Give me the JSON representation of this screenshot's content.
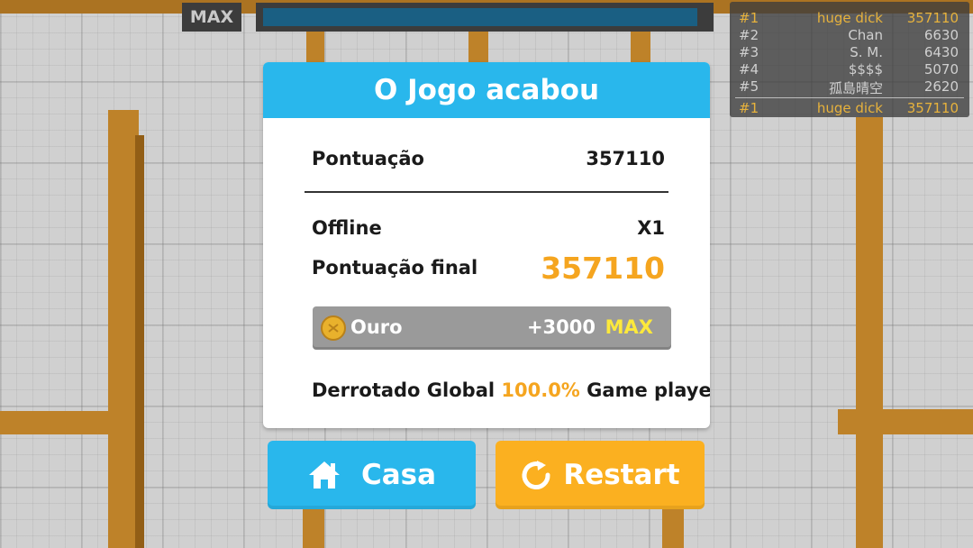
{
  "top": {
    "max_label": "MAX",
    "progress": 0.98
  },
  "leaderboard": {
    "rows": [
      {
        "rank": "#1",
        "name": "huge dick",
        "score": "357110"
      },
      {
        "rank": "#2",
        "name": "Chan",
        "score": "6630"
      },
      {
        "rank": "#3",
        "name": "S. M.",
        "score": "6430"
      },
      {
        "rank": "#4",
        "name": "$$$$",
        "score": "5070"
      },
      {
        "rank": "#5",
        "name": "孤島晴空",
        "score": "2620"
      }
    ],
    "self": {
      "rank": "#1",
      "name": "huge dick",
      "score": "357110"
    },
    "highlight_color": "#e7b23c"
  },
  "dialog": {
    "title": "O Jogo acabou",
    "score_label": "Pontuação",
    "score_value": "357110",
    "offline_label": "Offline",
    "offline_value": "X1",
    "final_label": "Pontuação final",
    "final_value": "357110",
    "gold": {
      "icon": "coin-icon",
      "label": "Ouro",
      "amount": "+3000",
      "max_label": "MAX"
    },
    "defeated": {
      "prefix": "Derrotado Global",
      "percent": "100.0%",
      "suffix": "Game players"
    },
    "header_color": "#29b7ec",
    "accent_color": "#f5a51f"
  },
  "buttons": {
    "home": {
      "icon": "home-icon",
      "label": "Casa",
      "color": "#29b7ec"
    },
    "restart": {
      "icon": "restart-icon",
      "label": "Restart",
      "color": "#fbb020"
    }
  }
}
